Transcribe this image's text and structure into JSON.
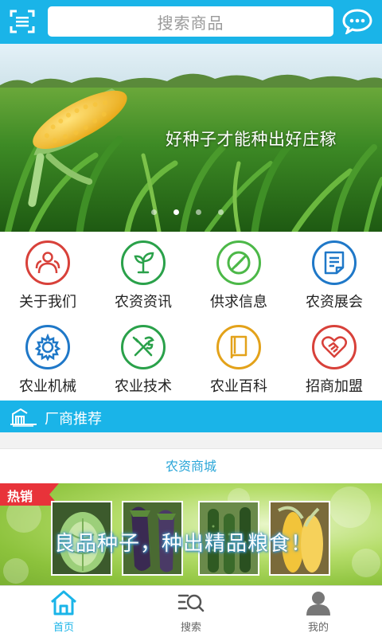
{
  "header": {
    "search_placeholder": "搜索商品",
    "scan_icon": "scan-icon",
    "chat_icon": "chat-bubble-icon"
  },
  "banner": {
    "caption": "好种子才能种出好庄稼",
    "slide_count": 4,
    "active_slide": 1
  },
  "categories": [
    {
      "label": "关于我们",
      "icon": "people-icon",
      "color": "#d8413a"
    },
    {
      "label": "农资资讯",
      "icon": "sprout-icon",
      "color": "#2aa14a"
    },
    {
      "label": "供求信息",
      "icon": "no-sign-icon",
      "color": "#4cb848"
    },
    {
      "label": "农资展会",
      "icon": "document-icon",
      "color": "#1f78c8"
    },
    {
      "label": "农业机械",
      "icon": "gear-icon",
      "color": "#1f78c8"
    },
    {
      "label": "农业技术",
      "icon": "tools-icon",
      "color": "#2aa14a"
    },
    {
      "label": "农业百科",
      "icon": "book-icon",
      "color": "#e3a21a"
    },
    {
      "label": "招商加盟",
      "icon": "handshake-icon",
      "color": "#d8413a"
    }
  ],
  "section": {
    "title": "厂商推荐",
    "icon": "factory-icon"
  },
  "mall": {
    "title": "农资商城",
    "hot_tag": "热销",
    "slogan": "良品种子，种出精品粮食！",
    "thumbnails": [
      "cabbage",
      "eggplant",
      "cucumber",
      "corn"
    ]
  },
  "bottom_nav": [
    {
      "label": "首页",
      "icon": "home-icon",
      "active": true
    },
    {
      "label": "搜索",
      "icon": "search-list-icon",
      "active": false
    },
    {
      "label": "我的",
      "icon": "user-icon",
      "active": false
    }
  ],
  "colors": {
    "primary": "#1ab4e8",
    "hot_red": "#e8333a"
  }
}
